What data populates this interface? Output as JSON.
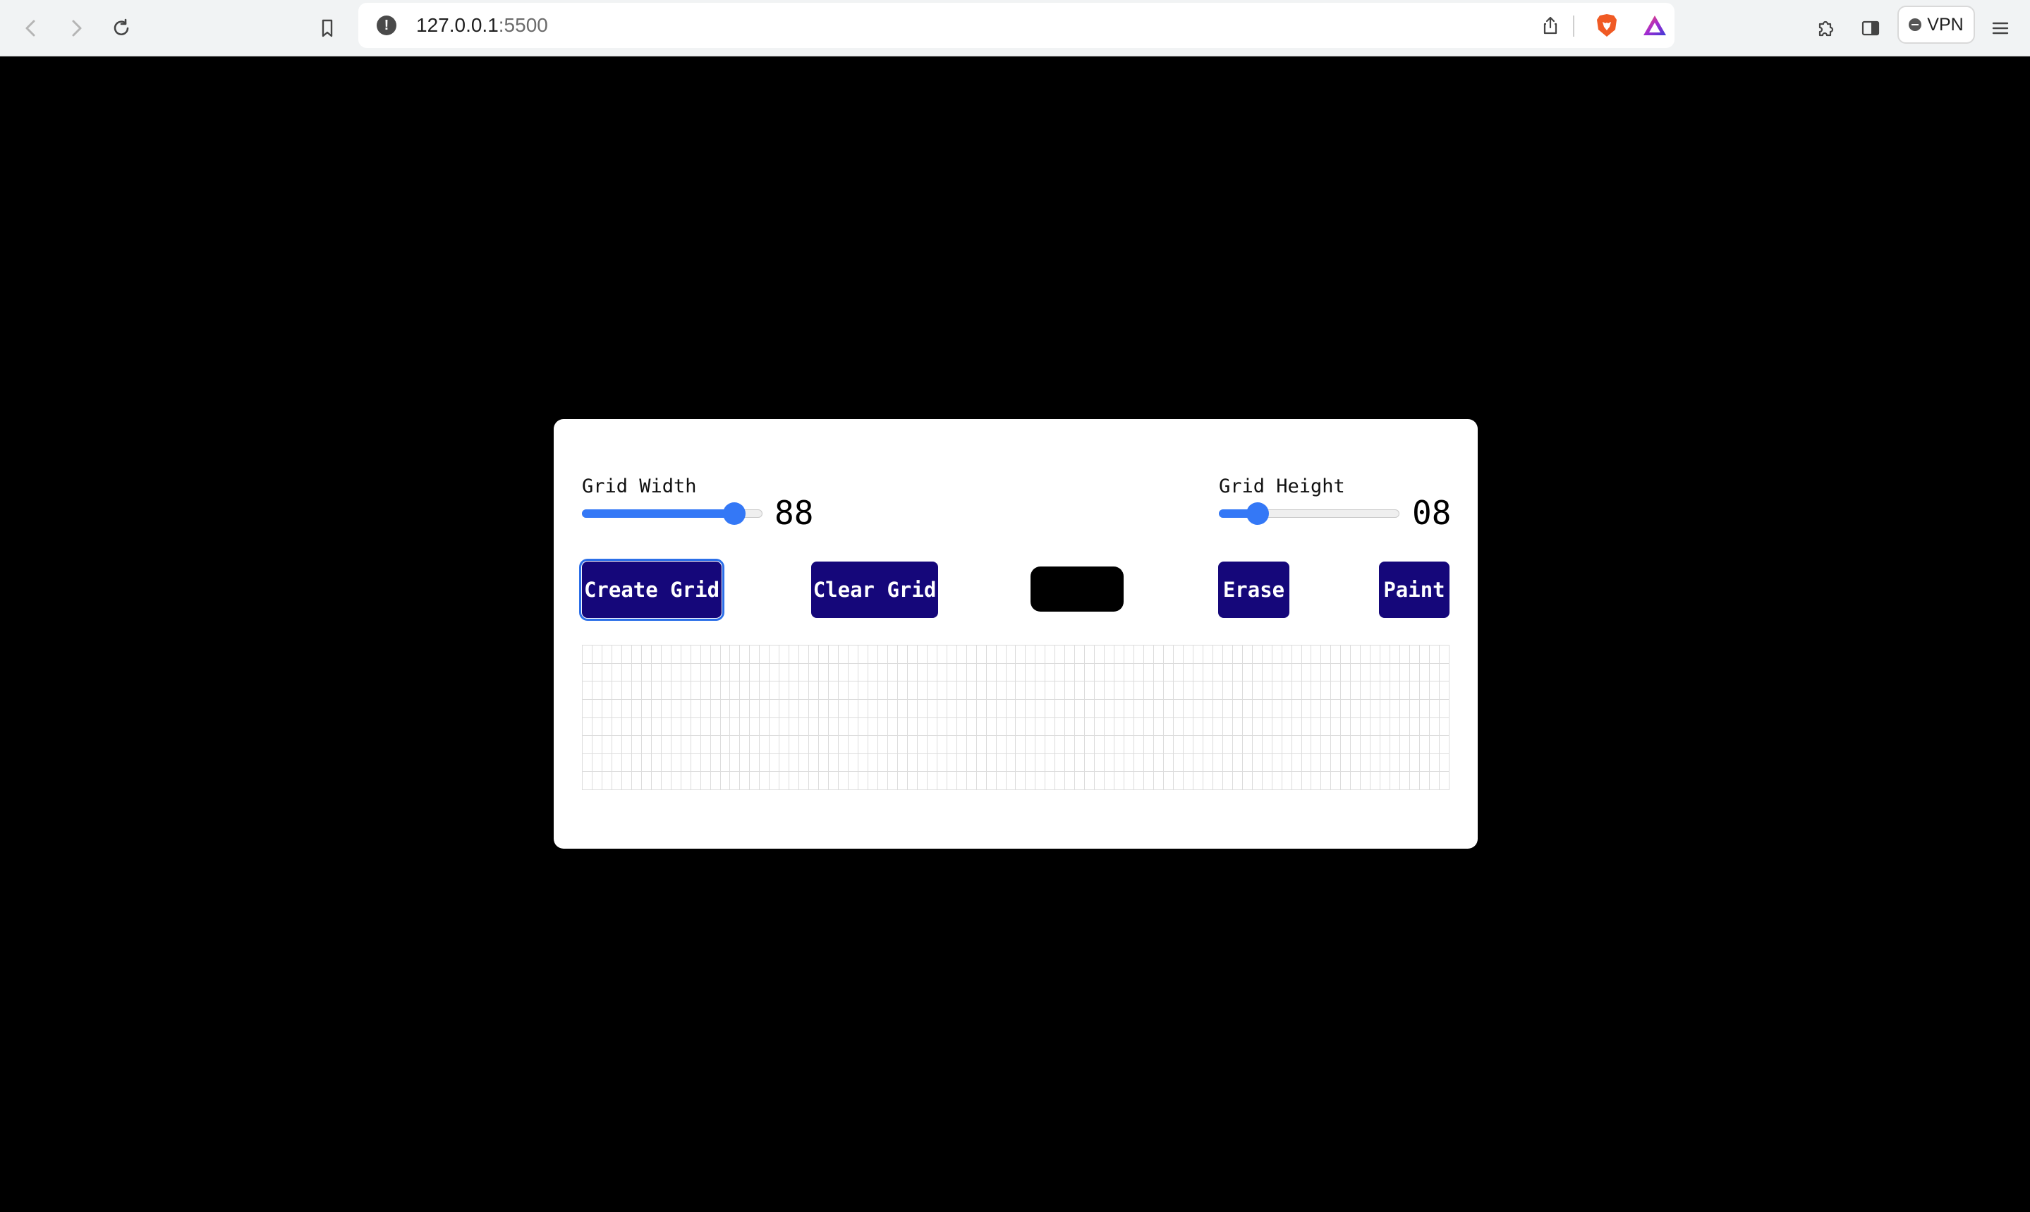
{
  "browser": {
    "url_host": "127.0.0.1",
    "url_port": ":5500",
    "vpn_label": "VPN",
    "icons": [
      "back-icon",
      "forward-icon",
      "reload-icon",
      "bookmark-icon",
      "site-info-icon",
      "share-icon",
      "brave-shields-icon",
      "brave-rewards-icon",
      "extensions-icon",
      "sidebar-icon",
      "menu-icon"
    ]
  },
  "controls": {
    "width_label": "Grid Width",
    "width_value": "88",
    "width_fill_fraction": 0.84,
    "height_label": "Grid Height",
    "height_value": "08",
    "height_fill_fraction": 0.21,
    "slider_color": "#3478f6"
  },
  "buttons": {
    "create": "Create Grid",
    "clear": "Clear Grid",
    "erase": "Erase",
    "paint": "Paint",
    "button_color": "#15077a"
  },
  "color_picker": {
    "value": "#000000"
  },
  "grid": {
    "columns": 88,
    "rows": 8
  }
}
